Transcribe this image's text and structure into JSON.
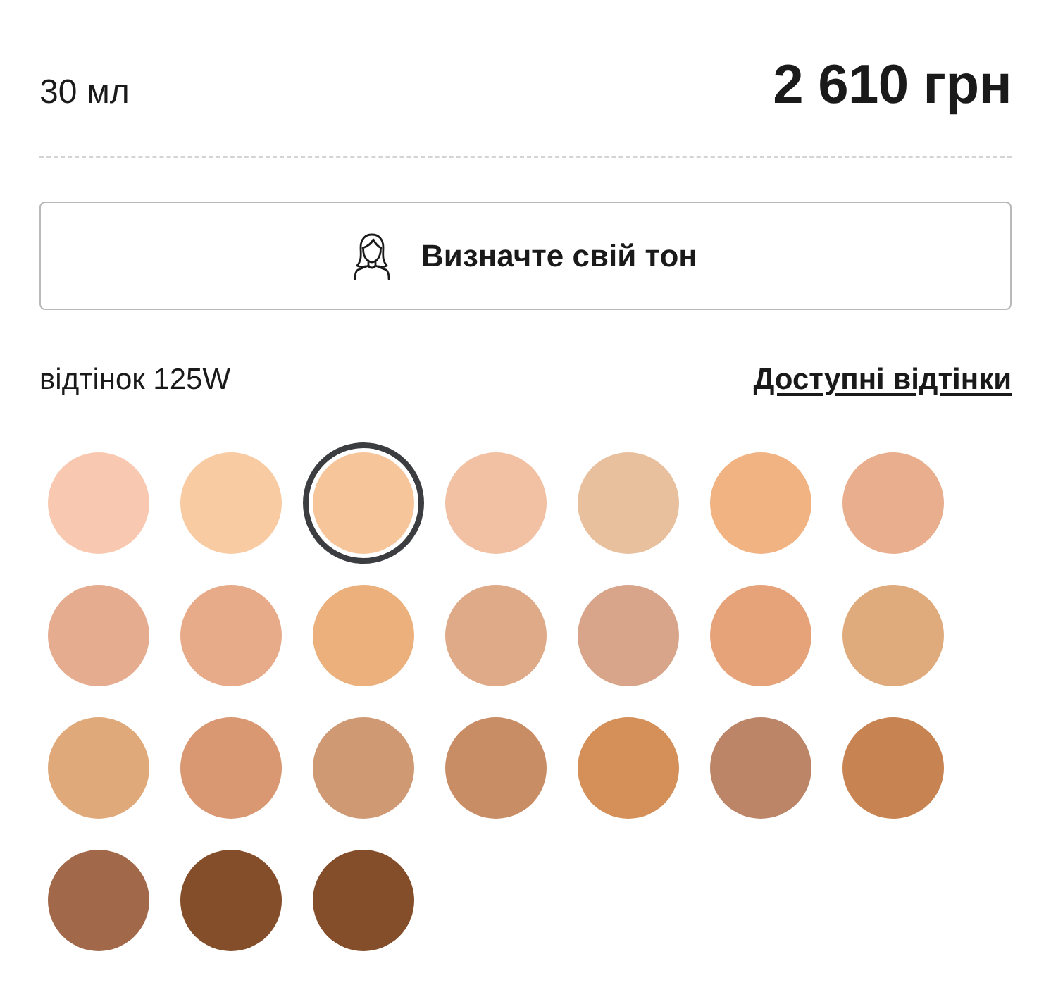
{
  "volume": "30 мл",
  "price": "2 610 грн",
  "tone_button": {
    "label": "Визначте свій тон"
  },
  "shade": {
    "label": "відтінок 125W",
    "link": "Доступні відтінки"
  },
  "swatches": [
    {
      "color": "#f8c9b0",
      "selected": false
    },
    {
      "color": "#f9cba2",
      "selected": false
    },
    {
      "color": "#f7c59a",
      "selected": true
    },
    {
      "color": "#f2c0a3",
      "selected": false
    },
    {
      "color": "#e8c09e",
      "selected": false
    },
    {
      "color": "#f2b383",
      "selected": false
    },
    {
      "color": "#e8ae8d",
      "selected": false
    },
    {
      "color": "#e6ac8f",
      "selected": false
    },
    {
      "color": "#e7ab89",
      "selected": false
    },
    {
      "color": "#ebb07c",
      "selected": false
    },
    {
      "color": "#dfaa88",
      "selected": false
    },
    {
      "color": "#d8a58b",
      "selected": false
    },
    {
      "color": "#e6a37a",
      "selected": false
    },
    {
      "color": "#e0ab7c",
      "selected": false
    },
    {
      "color": "#e0a97a",
      "selected": false
    },
    {
      "color": "#d99872",
      "selected": false
    },
    {
      "color": "#cf9974",
      "selected": false
    },
    {
      "color": "#c98d66",
      "selected": false
    },
    {
      "color": "#d49058",
      "selected": false
    },
    {
      "color": "#bd8567",
      "selected": false
    },
    {
      "color": "#c78452",
      "selected": false
    },
    {
      "color": "#a1694a",
      "selected": false
    },
    {
      "color": "#844e2a",
      "selected": false
    },
    {
      "color": "#844e2a",
      "selected": false
    }
  ]
}
